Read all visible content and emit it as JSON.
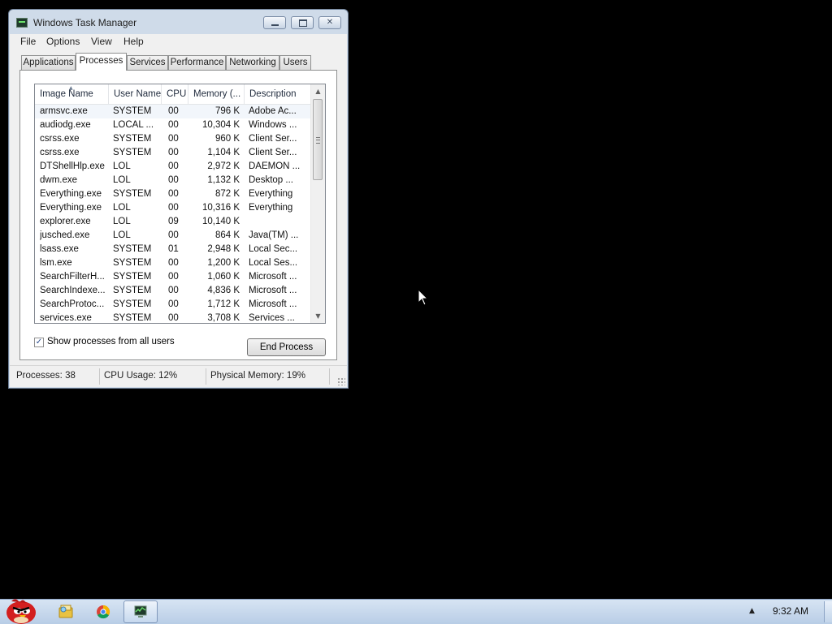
{
  "window": {
    "title": "Windows Task Manager",
    "minimize": "",
    "maximize": "",
    "close": "✕"
  },
  "menu": [
    "File",
    "Options",
    "View",
    "Help"
  ],
  "tabs": [
    "Applications",
    "Processes",
    "Services",
    "Performance",
    "Networking",
    "Users"
  ],
  "active_tab": "Processes",
  "columns": [
    "Image Name",
    "User Name",
    "CPU",
    "Memory (...",
    "Description"
  ],
  "processes": [
    {
      "name": "armsvc.exe",
      "user": "SYSTEM",
      "cpu": "00",
      "mem": "796 K",
      "desc": "Adobe Ac..."
    },
    {
      "name": "audiodg.exe",
      "user": "LOCAL ...",
      "cpu": "00",
      "mem": "10,304 K",
      "desc": "Windows ..."
    },
    {
      "name": "csrss.exe",
      "user": "SYSTEM",
      "cpu": "00",
      "mem": "960 K",
      "desc": "Client Ser..."
    },
    {
      "name": "csrss.exe",
      "user": "SYSTEM",
      "cpu": "00",
      "mem": "1,104 K",
      "desc": "Client Ser..."
    },
    {
      "name": "DTShellHlp.exe",
      "user": "LOL",
      "cpu": "00",
      "mem": "2,972 K",
      "desc": "DAEMON ..."
    },
    {
      "name": "dwm.exe",
      "user": "LOL",
      "cpu": "00",
      "mem": "1,132 K",
      "desc": "Desktop ..."
    },
    {
      "name": "Everything.exe",
      "user": "SYSTEM",
      "cpu": "00",
      "mem": "872 K",
      "desc": "Everything"
    },
    {
      "name": "Everything.exe",
      "user": "LOL",
      "cpu": "00",
      "mem": "10,316 K",
      "desc": "Everything"
    },
    {
      "name": "explorer.exe",
      "user": "LOL",
      "cpu": "09",
      "mem": "10,140 K",
      "desc": ""
    },
    {
      "name": "jusched.exe",
      "user": "LOL",
      "cpu": "00",
      "mem": "864 K",
      "desc": "Java(TM) ..."
    },
    {
      "name": "lsass.exe",
      "user": "SYSTEM",
      "cpu": "01",
      "mem": "2,948 K",
      "desc": "Local Sec..."
    },
    {
      "name": "lsm.exe",
      "user": "SYSTEM",
      "cpu": "00",
      "mem": "1,200 K",
      "desc": "Local Ses..."
    },
    {
      "name": "SearchFilterH...",
      "user": "SYSTEM",
      "cpu": "00",
      "mem": "1,060 K",
      "desc": "Microsoft ..."
    },
    {
      "name": "SearchIndexe...",
      "user": "SYSTEM",
      "cpu": "00",
      "mem": "4,836 K",
      "desc": "Microsoft ..."
    },
    {
      "name": "SearchProtoc...",
      "user": "SYSTEM",
      "cpu": "00",
      "mem": "1,712 K",
      "desc": "Microsoft ..."
    },
    {
      "name": "services.exe",
      "user": "SYSTEM",
      "cpu": "00",
      "mem": "3,708 K",
      "desc": "Services ..."
    }
  ],
  "show_all_label": "Show processes from all users",
  "show_all_checked": true,
  "end_process_label": "End Process",
  "status": {
    "processes": "Processes: 38",
    "cpu": "CPU Usage: 12%",
    "memory": "Physical Memory: 19%"
  },
  "taskbar": {
    "clock": "9:32 AM",
    "tray_arrow": "▲"
  },
  "colors": {
    "desktop": "#000000",
    "window_frame": "#cfdbe9",
    "taskbar": "#c6d8ee"
  }
}
